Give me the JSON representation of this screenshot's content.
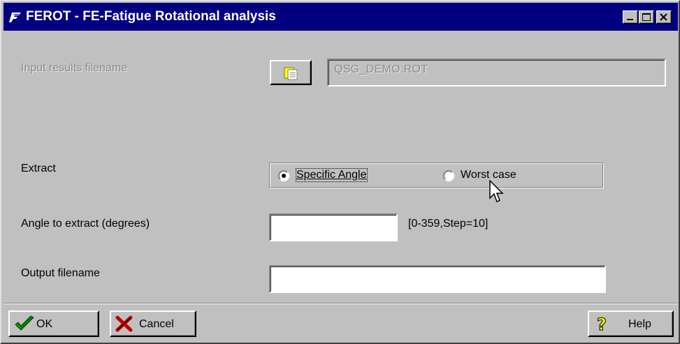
{
  "window": {
    "title": "FEROT - FE-Fatigue Rotational analysis",
    "controls": [
      "minimize-icon",
      "maximize-icon",
      "close-icon"
    ]
  },
  "input_results": {
    "label": "Input results filename",
    "value": "QSG_DEMO.ROT",
    "browse_icon": "folder-icon"
  },
  "extract": {
    "label": "Extract",
    "options": [
      {
        "label": "Specific Angle",
        "selected": true
      },
      {
        "label": "Worst case",
        "selected": false
      }
    ]
  },
  "angle": {
    "label": "Angle to extract (degrees)",
    "value": "",
    "hint": "[0-359,Step=10]"
  },
  "output": {
    "label": "Output filename",
    "value": ""
  },
  "buttons": {
    "ok": "OK",
    "cancel": "Cancel",
    "help": "Help"
  },
  "colors": {
    "titlebar": "#000080",
    "face": "#c0c0c0",
    "disabled_text": "#8a8a8a"
  }
}
